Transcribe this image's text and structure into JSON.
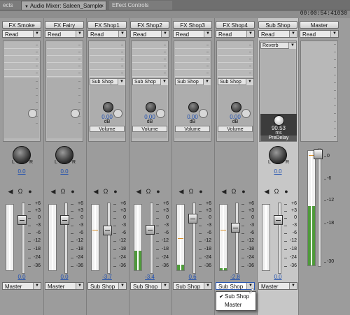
{
  "tabs": [
    {
      "label": "ects",
      "closable": false,
      "active": false
    },
    {
      "label": "Audio Mixer: Saleen_Sample",
      "closable": true,
      "active": true
    },
    {
      "label": "Effect Controls",
      "closable": false,
      "active": false
    }
  ],
  "timecode": "00:00:54:41030",
  "tracks": [
    {
      "name": "FX Smoke",
      "automation": "Read",
      "pan": "0.0",
      "pan_l": "L",
      "pan_r": "R",
      "volume": "0.0",
      "output": "Master",
      "meter_level": 0
    },
    {
      "name": "FX Fairy",
      "automation": "Read",
      "pan": "0.0",
      "pan_l": "L",
      "pan_r": "R",
      "volume": "0.0",
      "output": "Master",
      "meter_level": 0
    },
    {
      "name": "FX Shop1",
      "automation": "Read",
      "send": "Sub Shop",
      "send_value": "0.00",
      "send_unit": "dB",
      "send_param": "Volume",
      "volume": "-3.7",
      "output": "Sub Shop",
      "meter_level": 0
    },
    {
      "name": "FX Shop2",
      "automation": "Read",
      "send": "Sub Shop",
      "send_value": "0.00",
      "send_unit": "dB",
      "send_param": "Volume",
      "volume": "-3.4",
      "output": "Sub Shop",
      "meter_level": 0.3
    },
    {
      "name": "FX Shop3",
      "automation": "Read",
      "send": "Sub Shop",
      "send_value": "0.00",
      "send_unit": "dB",
      "send_param": "Volume",
      "volume": "0.6",
      "output": "Sub Shop",
      "meter_level": 0.08
    },
    {
      "name": "FX Shop4",
      "automation": "Read",
      "send": "Sub Shop",
      "send_value": "0.00",
      "send_unit": "dB",
      "send_param": "Volume",
      "volume": "-2.8",
      "output": "Sub Shop",
      "meter_level": 0.03
    },
    {
      "name": "Sub Shop",
      "automation": "Read",
      "effect": "Reverb",
      "effect_value": "90.53",
      "effect_unit": "ms",
      "effect_param": "PreDelay",
      "pan": "0.0",
      "pan_l": "L",
      "pan_r": "R",
      "volume": "0.0",
      "output": "Master",
      "meter_level": 0
    }
  ],
  "master": {
    "name": "Master",
    "automation": "Read",
    "meter_level": 0.52
  },
  "db_scale": [
    "+6",
    "+3",
    "0",
    "-3",
    "-6",
    "-12",
    "-18",
    "-24",
    "-36"
  ],
  "master_scale": [
    "0",
    "-6",
    "-12",
    "-18",
    "-30"
  ],
  "output_menu": {
    "items": [
      "Sub Shop",
      "Master"
    ],
    "checked": "Sub Shop"
  },
  "colors": {
    "meter_green": "#4e9a3a",
    "value_blue": "#1f4fb0",
    "panel_bg": "#9c9c9c"
  }
}
